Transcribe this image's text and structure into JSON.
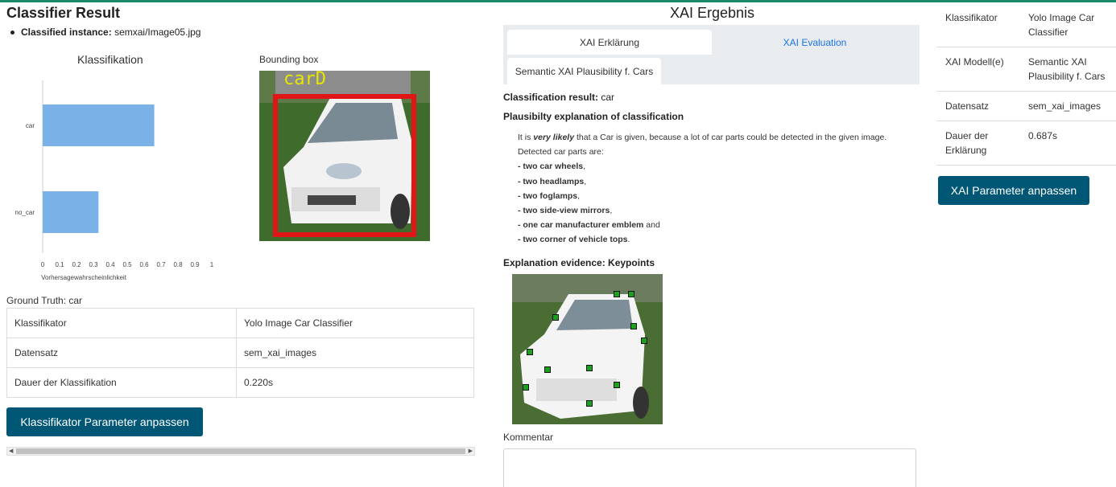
{
  "left": {
    "title": "Classifier Result",
    "instance_label": "Classified instance",
    "instance_value": "semxai/Image05.jpg",
    "bounding_box_label": "Bounding box",
    "bbox_overlay_label": "carD",
    "ground_truth": "Ground Truth: car",
    "table": [
      {
        "key": "Klassifikator",
        "value": "Yolo Image Car Classifier"
      },
      {
        "key": "Datensatz",
        "value": "sem_xai_images"
      },
      {
        "key": "Dauer der Klassifikation",
        "value": "0.220s"
      }
    ],
    "button": "Klassifikator Parameter anpassen"
  },
  "chart_data": {
    "type": "bar",
    "orientation": "horizontal",
    "title": "Klassifikation",
    "xlabel": "Vorhersagewahrscheinlichkeit",
    "ylabel": "",
    "categories": [
      "car",
      "no_car"
    ],
    "values": [
      0.66,
      0.33
    ],
    "xlim": [
      0,
      1
    ],
    "xticks": [
      "0",
      "0.1",
      "0.2",
      "0.3",
      "0.4",
      "0.5",
      "0.6",
      "0.7",
      "0.8",
      "0.9",
      "1"
    ],
    "bar_color": "#7ab2e8",
    "grid": false
  },
  "middle": {
    "title": "XAI Ergebnis",
    "tabs": [
      {
        "label": "XAI Erklärung",
        "active": true
      },
      {
        "label": "XAI Evaluation",
        "active": false
      }
    ],
    "subtab": "Semantic XAI Plausibility f. Cars",
    "classification_result_label": "Classification result:",
    "classification_result_value": "car",
    "plausibility_heading": "Plausibilty explanation of classification",
    "expl_intro_1": "It is",
    "expl_very_likely": "very likely",
    "expl_intro_2": "that a Car is given, because a lot of car parts could be detected in the given image.",
    "expl_detected": "Detected car parts are:",
    "parts": [
      {
        "text": "- two car wheels",
        "sep": ","
      },
      {
        "text": "- two headlamps",
        "sep": ","
      },
      {
        "text": "- two foglamps",
        "sep": ","
      },
      {
        "text": "- two side-view mirrors",
        "sep": ","
      },
      {
        "text": "- one car manufacturer emblem",
        "sep": " and"
      },
      {
        "text": "- two corner of vehicle tops",
        "sep": "."
      }
    ],
    "evidence_heading": "Explanation evidence: Keypoints",
    "kommentar_label": "Kommentar",
    "kommentar_value": ""
  },
  "right": {
    "table": [
      {
        "key": "Klassifikator",
        "value": "Yolo Image Car Classifier"
      },
      {
        "key": "XAI Modell(e)",
        "value": "Semantic XAI Plausibility f. Cars"
      },
      {
        "key": "Datensatz",
        "value": "sem_xai_images"
      },
      {
        "key": "Dauer der Erklärung",
        "value": "0.687s"
      }
    ],
    "button": "XAI Parameter anpassen"
  },
  "colors": {
    "accent_top": "#1a8a6b",
    "button": "#005775",
    "link_tab": "#1a73e8",
    "bbox": "#e01616",
    "keypoint": "#1aa31a"
  }
}
